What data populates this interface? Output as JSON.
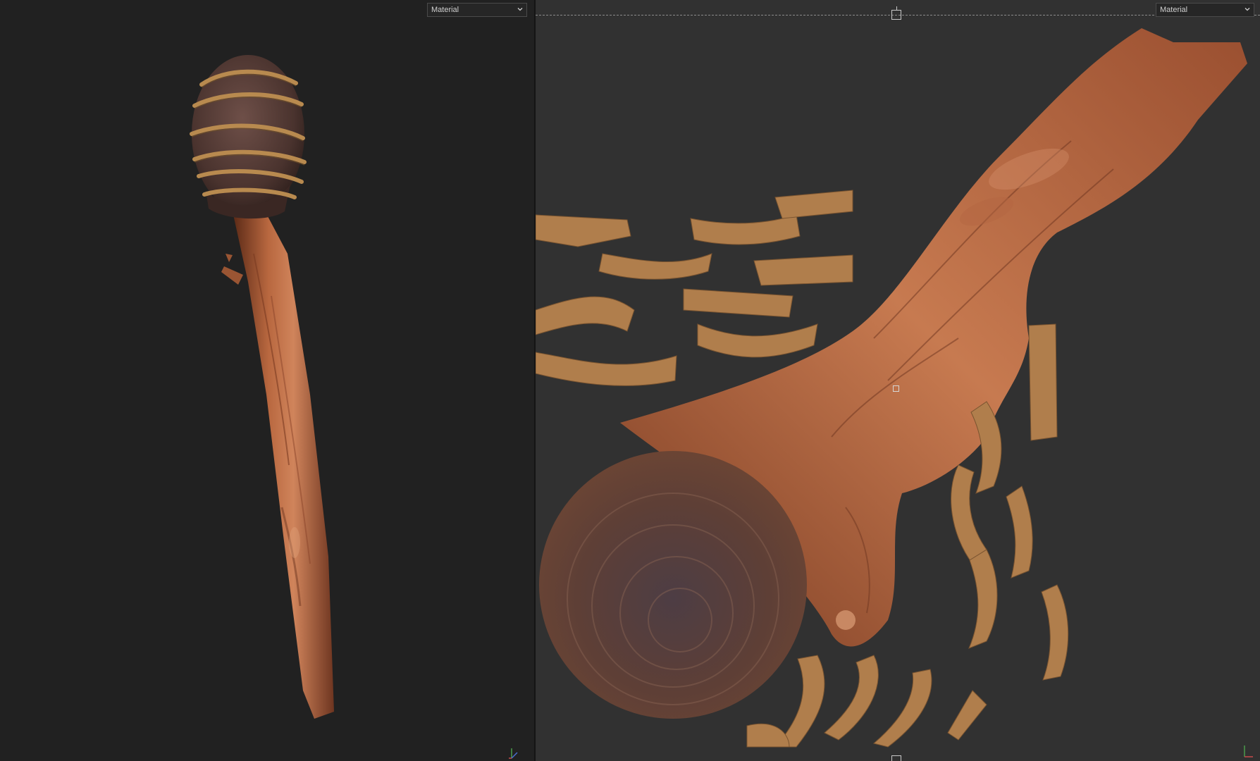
{
  "viewport_3d": {
    "display_mode": "Material",
    "icons": {
      "dropdown": "chevron-down-icon",
      "axis": "axis-gizmo-icon"
    }
  },
  "viewport_2d": {
    "display_mode": "Material",
    "icons": {
      "dropdown": "chevron-down-icon",
      "axis": "axis-gizmo-icon"
    }
  },
  "colors": {
    "bg_3d": "#212121",
    "bg_2d": "#313131",
    "wood": "#b8673f",
    "wood_dark": "#6e3520",
    "cloth": "#5a3e37",
    "rope": "#b88a4f"
  }
}
